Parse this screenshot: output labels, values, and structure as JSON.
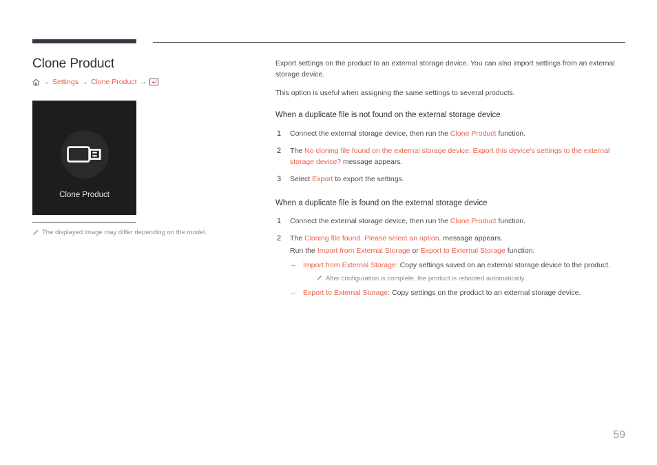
{
  "page": {
    "title": "Clone Product",
    "number": "59"
  },
  "breadcrumb": {
    "home_icon": "home-icon",
    "arrow": "→",
    "items": [
      "Settings",
      "Clone Product"
    ],
    "enter_icon": "enter-key-icon"
  },
  "preview": {
    "icon": "usb-drive-icon",
    "caption": "Clone Product",
    "note_icon": "pencil-icon",
    "note": "The displayed image may differ depending on the model."
  },
  "intro": {
    "p1": "Export settings on the product to an external storage device. You can also import settings from an external storage device.",
    "p2": "This option is useful when assigning the same settings to several products."
  },
  "section_not_found": {
    "heading": "When a duplicate file is not found on the external storage device",
    "steps": [
      {
        "num": "1",
        "pre": "Connect the external storage device, then run the ",
        "accent": "Clone Product",
        "post": " function."
      },
      {
        "num": "2",
        "pre": "The ",
        "accent": "No cloning file found on the external storage device. Export this device's settings to the external storage device?",
        "post": " message appears."
      },
      {
        "num": "3",
        "pre": "Select ",
        "accent": "Export",
        "post": " to export the settings."
      }
    ]
  },
  "section_found": {
    "heading": "When a duplicate file is found on the external storage device",
    "steps": [
      {
        "num": "1",
        "pre": "Connect the external storage device, then run the ",
        "accent": "Clone Product",
        "post": " function."
      },
      {
        "num": "2",
        "pre": "The ",
        "accent": "Cloning file found. Please select an option.",
        "post": " message appears."
      }
    ],
    "run_line": {
      "pre": "Run the ",
      "accent1": "Import from External Storage",
      "mid": " or ",
      "accent2": "Export to External Storage",
      "post": " function."
    },
    "options": [
      {
        "dash": "–",
        "accent": "Import from External Storage",
        "text": ": Copy settings saved on an external storage device to the product."
      },
      {
        "dash": "–",
        "accent": "Export to External Storage",
        "text": ": Copy settings on the product to an external storage device."
      }
    ],
    "option_note": {
      "icon": "pencil-icon",
      "text": "After configuration is complete, the product is rebooted automatically."
    }
  },
  "colors": {
    "accent": "#e8604c",
    "rule_dark": "#3b3742",
    "panel_bg": "#1e1c1d",
    "body_text": "#4a4a4a"
  }
}
